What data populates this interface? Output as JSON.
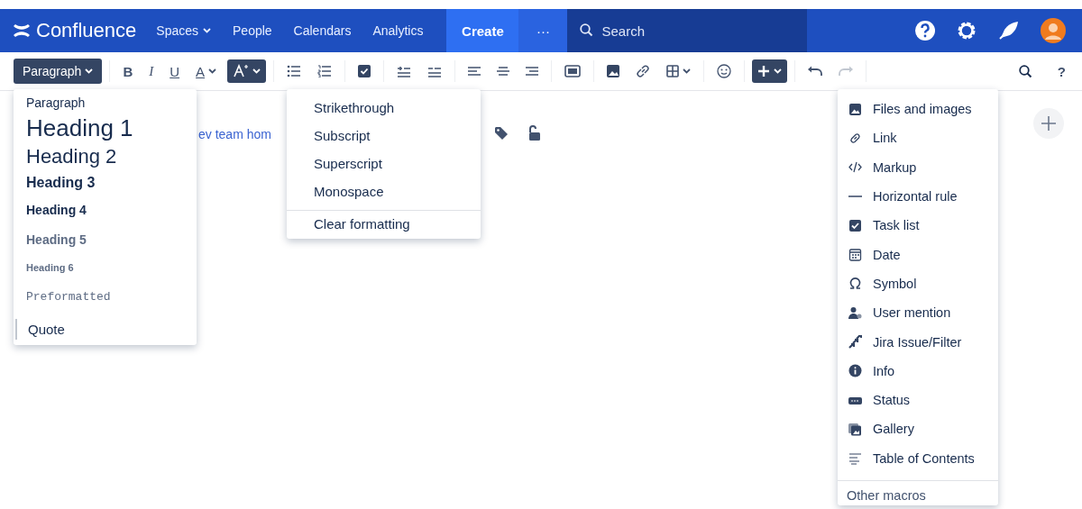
{
  "navbar": {
    "logo": "Confluence",
    "items": [
      {
        "label": "Spaces",
        "caret": true
      },
      {
        "label": "People"
      },
      {
        "label": "Calendars"
      },
      {
        "label": "Analytics"
      }
    ],
    "create": "Create",
    "more": "···",
    "search": {
      "placeholder": "Search"
    }
  },
  "toolbar": {
    "groups": [
      [
        {
          "kind": "label",
          "label": "Paragraph",
          "caret": true,
          "selected": true
        }
      ],
      [
        {
          "kind": "label",
          "label": "B",
          "selected": false
        },
        {
          "kind": "label",
          "label": "I",
          "selected": false
        },
        {
          "kind": "label",
          "label": "U",
          "selected": false
        },
        {
          "kind": "label",
          "label": "A",
          "caret": true,
          "selected": false
        },
        {
          "kind": "icon",
          "caret": true,
          "selected": true
        }
      ],
      [
        {
          "kind": "icon",
          "selected": false
        },
        {
          "kind": "icon",
          "selected": false
        }
      ],
      [
        {
          "kind": "icon",
          "selected": false
        }
      ],
      [
        {
          "kind": "icon",
          "selected": false
        },
        {
          "kind": "icon",
          "selected": false
        }
      ],
      [
        {
          "kind": "icon",
          "selected": false
        },
        {
          "kind": "icon",
          "selected": false
        },
        {
          "kind": "icon",
          "selected": false
        }
      ],
      [
        {
          "kind": "icon",
          "selected": false
        }
      ],
      [
        {
          "kind": "icon",
          "selected": false
        },
        {
          "kind": "icon",
          "selected": false
        },
        {
          "kind": "icon",
          "caret": true,
          "selected": false
        }
      ],
      [
        {
          "kind": "icon",
          "selected": false
        }
      ],
      [
        {
          "kind": "icon",
          "caret": true,
          "selected": true
        }
      ],
      [
        {
          "kind": "icon",
          "selected": false,
          "disabled": false
        },
        {
          "kind": "icon",
          "selected": false,
          "disabled": true
        }
      ]
    ],
    "right": [
      {
        "kind": "icon"
      },
      {
        "kind": "label",
        "label": "?"
      }
    ]
  },
  "page": {
    "breadcrumb": "ev team hom"
  },
  "paragraph_menu": [
    {
      "label": "Paragraph",
      "kind": "paragraph"
    },
    {
      "label": "Heading 1",
      "kind": "h1"
    },
    {
      "label": "Heading 2",
      "kind": "h2"
    },
    {
      "label": "Heading 3",
      "kind": "h3"
    },
    {
      "label": "Heading 4",
      "kind": "h4"
    },
    {
      "label": "Heading 5",
      "kind": "h5"
    },
    {
      "label": "Heading 6",
      "kind": "h6"
    },
    {
      "label": "Preformatted",
      "kind": "pre"
    },
    {
      "label": "Quote",
      "kind": "quote"
    }
  ],
  "format_menu": {
    "items": [
      "Strikethrough",
      "Subscript",
      "Superscript",
      "Monospace"
    ],
    "clear": "Clear formatting"
  },
  "insert_menu": {
    "items": [
      "Files and images",
      "Link",
      "Markup",
      "Horizontal rule",
      "Task list",
      "Date",
      "Symbol",
      "User mention",
      "Jira Issue/Filter",
      "Info",
      "Status",
      "Gallery",
      "Table of Contents"
    ],
    "footer": "Other macros"
  }
}
